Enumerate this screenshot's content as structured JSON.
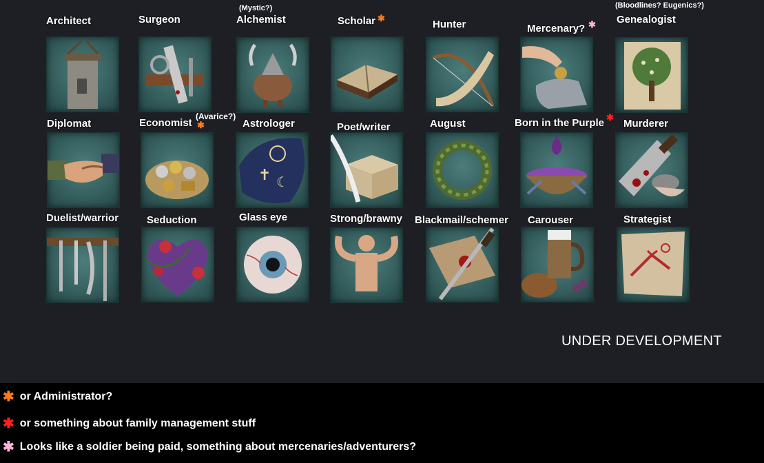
{
  "traits": [
    {
      "label": "Architect",
      "icon": "tower-icon"
    },
    {
      "label": "Surgeon",
      "icon": "surgical-tools-icon"
    },
    {
      "label": "Alchemist",
      "note": "(Mystic?)",
      "icon": "incense-burner-icon"
    },
    {
      "label": "Scholar",
      "icon": "open-book-icon",
      "star": "orange"
    },
    {
      "label": "Hunter",
      "icon": "bow-and-horn-icon"
    },
    {
      "label": "Mercenary?",
      "icon": "coin-payment-icon",
      "star": "pink"
    },
    {
      "label": "Genealogist",
      "note": "(Bloodlines? Eugenics?)",
      "icon": "family-tree-scroll-icon"
    },
    {
      "label": "Diplomat",
      "icon": "handshake-icon"
    },
    {
      "label": "Economist",
      "note": "(Avarice?)",
      "icon": "coin-pile-icon",
      "star": "orange"
    },
    {
      "label": "Astrologer",
      "icon": "star-cloth-icon"
    },
    {
      "label": "Poet/writer",
      "icon": "book-and-quill-icon"
    },
    {
      "label": "August",
      "icon": "laurel-wreath-icon"
    },
    {
      "label": "Born in the Purple",
      "icon": "purple-dye-bowl-icon",
      "star": "red"
    },
    {
      "label": "Murderer",
      "icon": "bloody-cleaver-icon"
    },
    {
      "label": "Duelist/warrior",
      "icon": "weapon-rack-icon"
    },
    {
      "label": "Seduction",
      "icon": "rose-heart-icon"
    },
    {
      "label": "Glass eye",
      "icon": "eyeball-icon"
    },
    {
      "label": "Strong/brawny",
      "icon": "flexing-man-icon"
    },
    {
      "label": "Blackmail/schemer",
      "icon": "sealed-letter-dagger-icon"
    },
    {
      "label": "Carouser",
      "icon": "tankard-feast-icon"
    },
    {
      "label": "Strategist",
      "icon": "battle-map-icon"
    }
  ],
  "status": "UNDER DEVELOPMENT",
  "legend": [
    {
      "color": "orange",
      "text": "or Administrator?"
    },
    {
      "color": "red",
      "text": "or something about family management stuff"
    },
    {
      "color": "pink",
      "text": "Looks like a soldier being paid, something about mercenaries/adventurers?"
    }
  ],
  "colors": {
    "background": "#1e1f24",
    "tile": "#36605f",
    "legend_bg": "#000000",
    "star_orange": "#ff7a1a",
    "star_red": "#ff2020",
    "star_pink": "#ffb3d9"
  }
}
